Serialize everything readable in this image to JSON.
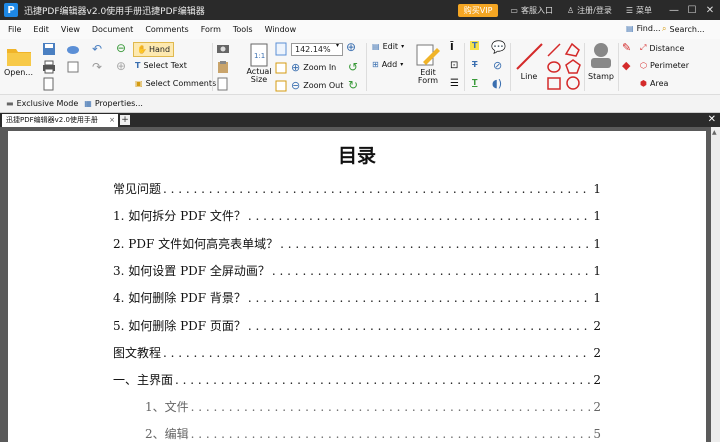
{
  "titlebar": {
    "logo_letter": "P",
    "title": "迅捷PDF编辑器v2.0使用手册迅捷PDF编辑器",
    "vip_label": "购买VIP",
    "service_label": "客服入口",
    "login_label": "注册/登录",
    "menu_label": "菜单"
  },
  "menubar": [
    "File",
    "Edit",
    "View",
    "Document",
    "Comments",
    "Form",
    "Tools",
    "Window"
  ],
  "toolbar": {
    "open_label": "Open...",
    "hand_label": "Hand",
    "select_text_label": "Select Text",
    "select_comments_label": "Select Comments",
    "zoom_value": "142.14%",
    "actual_size_label": "Actual Size",
    "zoom_in_label": "Zoom In",
    "zoom_out_label": "Zoom Out",
    "edit_label": "Edit",
    "add_label": "Add",
    "edit_form_label": "Edit Form",
    "line_label": "Line",
    "stamp_label": "Stamp",
    "find_label": "Find...",
    "search_label": "Search...",
    "distance_label": "Distance",
    "perimeter_label": "Perimeter",
    "area_label": "Area"
  },
  "subbar": {
    "exclusive_label": "Exclusive Mode",
    "properties_label": "Properties..."
  },
  "tabs": {
    "doc_tab": "迅捷PDF编辑器v2.0使用手册",
    "close": "×",
    "add": "+"
  },
  "document": {
    "title": "目录",
    "toc": [
      {
        "label": "常见问题",
        "page": "1",
        "sub": false
      },
      {
        "label": "1.  如何拆分 PDF 文件？",
        "page": "1",
        "sub": false
      },
      {
        "label": "2.  PDF 文件如何高亮表单域？",
        "page": "1",
        "sub": false
      },
      {
        "label": "3.  如何设置 PDF 全屏动画？",
        "page": "1",
        "sub": false
      },
      {
        "label": "4.  如何删除 PDF 背景？",
        "page": "1",
        "sub": false
      },
      {
        "label": "5.  如何删除 PDF 页面？",
        "page": "2",
        "sub": false
      },
      {
        "label": "图文教程",
        "page": "2",
        "sub": false
      },
      {
        "label": "一、主界面",
        "page": "2",
        "sub": false
      },
      {
        "label": "1、文件",
        "page": "2",
        "sub": true
      },
      {
        "label": "2、编辑",
        "page": "5",
        "sub": true
      }
    ]
  },
  "colors": {
    "titlebar": "#2a2a2a",
    "vip": "#f5a623",
    "accent": "#1e88e5",
    "doc_background": "#5a5a5a"
  }
}
